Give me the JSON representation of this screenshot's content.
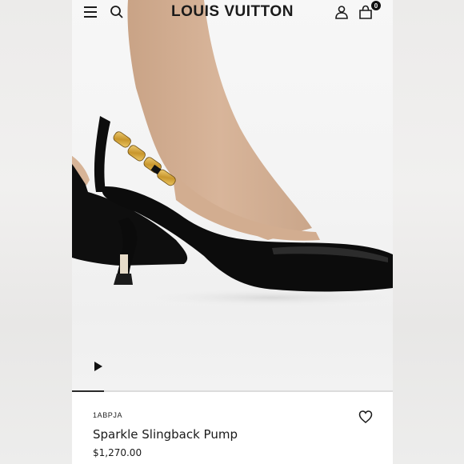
{
  "header": {
    "brand": "LOUIS VUITTON",
    "bag_count": "0",
    "icons": [
      "menu-icon",
      "search-icon",
      "account-icon",
      "shopping-bag-icon"
    ]
  },
  "media": {
    "progress": 0.1,
    "controls": [
      "play-icon"
    ]
  },
  "product": {
    "sku": "1ABPJA",
    "name": "Sparkle Slingback Pump",
    "price": "$1,270.00",
    "wishlist_icon": "heart-icon"
  },
  "colors": {
    "text": "#1a1a1a",
    "badge": "#111111"
  }
}
